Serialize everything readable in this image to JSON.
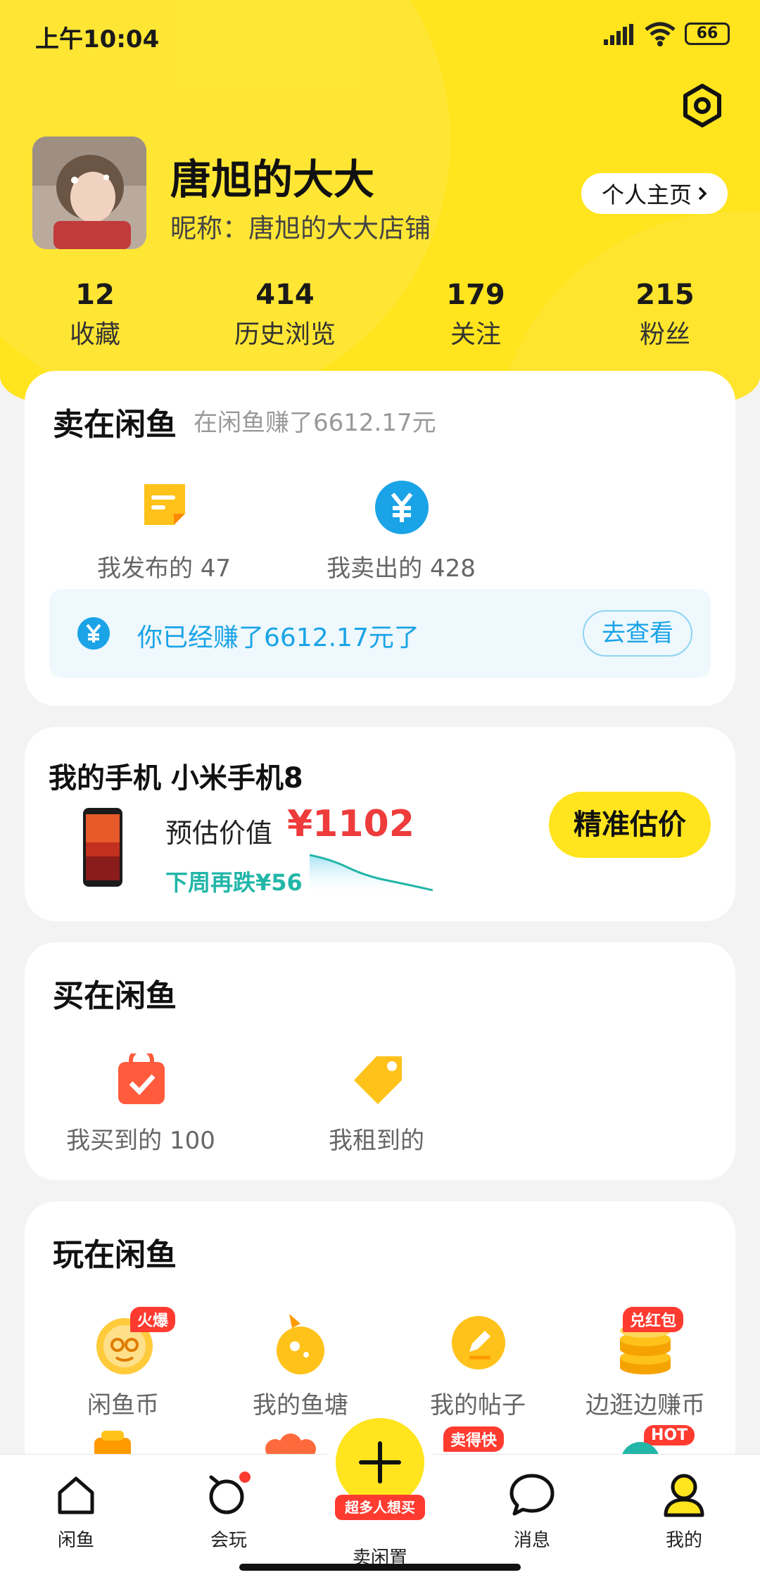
{
  "status_bar": {
    "time": "上午10:04",
    "battery": "66"
  },
  "profile": {
    "name": "唐旭的大大",
    "nickname": "昵称：唐旭的大大店铺",
    "homepage_button": "个人主页"
  },
  "stats": [
    {
      "value": "12",
      "label": "收藏"
    },
    {
      "value": "414",
      "label": "历史浏览"
    },
    {
      "value": "179",
      "label": "关注"
    },
    {
      "value": "215",
      "label": "粉丝"
    }
  ],
  "sell": {
    "title": "卖在闲鱼",
    "subtitle": "在闲鱼赚了6612.17元",
    "items": [
      {
        "label": "我发布的 47",
        "icon": "published-icon"
      },
      {
        "label": "我卖出的 428",
        "icon": "sold-yen-icon"
      }
    ],
    "banner_text": "你已经赚了6612.17元了",
    "banner_button": "去查看"
  },
  "phone": {
    "title": "我的手机 小米手机8",
    "estimate_label": "预估价值",
    "price": "¥1102",
    "trend": "下周再跌¥56",
    "button": "精准估价"
  },
  "buy": {
    "title": "买在闲鱼",
    "items": [
      {
        "label": "我买到的 100",
        "icon": "bought-bag-icon"
      },
      {
        "label": "我租到的",
        "icon": "rent-tag-icon"
      }
    ]
  },
  "play": {
    "title": "玩在闲鱼",
    "items": [
      {
        "label": "闲鱼币",
        "badge": "火爆",
        "icon": "xianyu-coin-icon"
      },
      {
        "label": "我的鱼塘",
        "badge": "",
        "icon": "fish-pond-icon"
      },
      {
        "label": "我的帖子",
        "badge": "",
        "icon": "my-posts-icon"
      },
      {
        "label": "边逛边赚币",
        "badge": "兑红包",
        "icon": "coin-stack-icon"
      }
    ],
    "row2_badges": [
      "卖得快",
      "HOT"
    ]
  },
  "tabbar": {
    "items": [
      {
        "label": "闲鱼",
        "icon": "home-icon"
      },
      {
        "label": "会玩",
        "icon": "play-icon"
      },
      {
        "label": "卖闲置",
        "icon": "plus-icon",
        "badge": "超多人想买"
      },
      {
        "label": "消息",
        "icon": "message-icon"
      },
      {
        "label": "我的",
        "icon": "profile-icon"
      }
    ]
  },
  "colors": {
    "brand_yellow": "#ffe41e",
    "price_red": "#ee3b3b",
    "link_blue": "#1aa3e6",
    "trend_teal": "#22b6a8"
  }
}
